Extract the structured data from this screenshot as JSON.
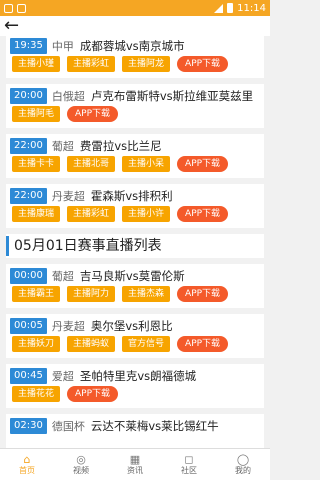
{
  "status_bar": {
    "time": "11:14"
  },
  "matches_top": [
    {
      "time": "19:35",
      "league": "中甲",
      "match": "成都蓉城vs南京城市",
      "chips": [
        "主播小瑾",
        "主播彩虹",
        "主播阿龙",
        "APP下载"
      ]
    },
    {
      "time": "20:00",
      "league": "白俄超",
      "match": "卢克布雷斯特vs斯拉维亚莫兹里",
      "chips": [
        "主播阿毛",
        "APP下载"
      ]
    },
    {
      "time": "22:00",
      "league": "葡超",
      "match": "费雷拉vs比兰尼",
      "chips": [
        "主播卡卡",
        "主播北哥",
        "主播小呆",
        "APP下载"
      ]
    },
    {
      "time": "22:00",
      "league": "丹麦超",
      "match": "霍森斯vs排积利",
      "chips": [
        "主播康瑞",
        "主播彩虹",
        "主播小许",
        "APP下载"
      ]
    }
  ],
  "section": {
    "title": "05月01日赛事直播列表"
  },
  "matches_bottom": [
    {
      "time": "00:00",
      "league": "葡超",
      "match": "吉马良斯vs莫雷伦斯",
      "chips": [
        "主播霸王",
        "主播阿力",
        "主播杰森",
        "APP下载"
      ]
    },
    {
      "time": "00:05",
      "league": "丹麦超",
      "match": "奥尔堡vs利恩比",
      "chips": [
        "主播妖刀",
        "主播蚂蚁",
        "官方信号",
        "APP下载"
      ]
    },
    {
      "time": "00:45",
      "league": "爱超",
      "match": "圣帕特里克vs朗福德城",
      "chips": [
        "主播花花",
        "APP下载"
      ]
    },
    {
      "time": "02:30",
      "league": "德国杯",
      "match": "云达不莱梅vs莱比锡红牛",
      "chips": []
    }
  ],
  "tabbar": {
    "tabs": [
      {
        "icon": "home-icon",
        "glyph": "⌂",
        "label": "首页"
      },
      {
        "icon": "video-icon",
        "glyph": "◎",
        "label": "视频"
      },
      {
        "icon": "news-icon",
        "glyph": "▦",
        "label": "资讯"
      },
      {
        "icon": "chat-icon",
        "glyph": "◻",
        "label": "社区"
      },
      {
        "icon": "profile-icon",
        "glyph": "◯",
        "label": "我的"
      }
    ]
  }
}
